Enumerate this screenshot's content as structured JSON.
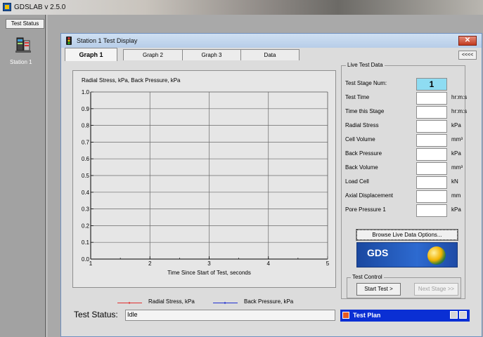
{
  "app": {
    "title": "GDSLAB v 2.5.0"
  },
  "left_panel": {
    "tab_label": "Test Status",
    "station_label": "Station 1"
  },
  "window": {
    "title": "Station 1 Test Display",
    "close_glyph": "✕"
  },
  "tabs": [
    {
      "label": "Graph 1",
      "active": true
    },
    {
      "label": "Graph 2",
      "active": false
    },
    {
      "label": "Graph 3",
      "active": false
    },
    {
      "label": "Data",
      "active": false
    }
  ],
  "tab_scroll_label": "<<<<",
  "chart_data": {
    "type": "line",
    "title": "Radial Stress, kPa, Back Pressure, kPa",
    "xlabel": "Time Since Start of Test, seconds",
    "ylabel": "",
    "xlim": [
      1,
      5
    ],
    "ylim": [
      0.0,
      1.0
    ],
    "x_ticks": [
      "1",
      "2",
      "3",
      "4",
      "5"
    ],
    "y_ticks": [
      "0.0",
      "0.1",
      "0.2",
      "0.3",
      "0.4",
      "0.5",
      "0.6",
      "0.7",
      "0.8",
      "0.9",
      "1.0"
    ],
    "grid": true,
    "series": [
      {
        "name": "Radial Stress, kPa",
        "color": "#e03030",
        "values": []
      },
      {
        "name": "Back Pressure, kPa",
        "color": "#2030d0",
        "values": []
      }
    ]
  },
  "test_status": {
    "label": "Test Status:",
    "value": "Idle"
  },
  "live_data": {
    "legend": "Live Test Data",
    "fields": [
      {
        "label": "Test Stage Num:",
        "value": "1",
        "unit": "",
        "highlight": true
      },
      {
        "label": "Test Time",
        "value": "",
        "unit": "hr:m:s"
      },
      {
        "label": "Time this Stage",
        "value": "",
        "unit": "hr:m:s"
      },
      {
        "label": "Radial Stress",
        "value": "",
        "unit": "kPa"
      },
      {
        "label": "Cell Volume",
        "value": "",
        "unit": "mm³"
      },
      {
        "label": "Back Pressure",
        "value": "",
        "unit": "kPa"
      },
      {
        "label": "Back Volume",
        "value": "",
        "unit": "mm³"
      },
      {
        "label": "Load Cell",
        "value": "",
        "unit": "kN"
      },
      {
        "label": "Axial Displacement",
        "value": "",
        "unit": "mm"
      },
      {
        "label": "Pore Pressure 1",
        "value": "",
        "unit": "kPa"
      }
    ],
    "browse_button": "Browse Live Data Options...",
    "logo_text": "GDS"
  },
  "test_control": {
    "legend": "Test Control",
    "start_label": "Start Test >",
    "next_label": "Next Stage >>"
  },
  "test_plan": {
    "label": "Test Plan"
  }
}
